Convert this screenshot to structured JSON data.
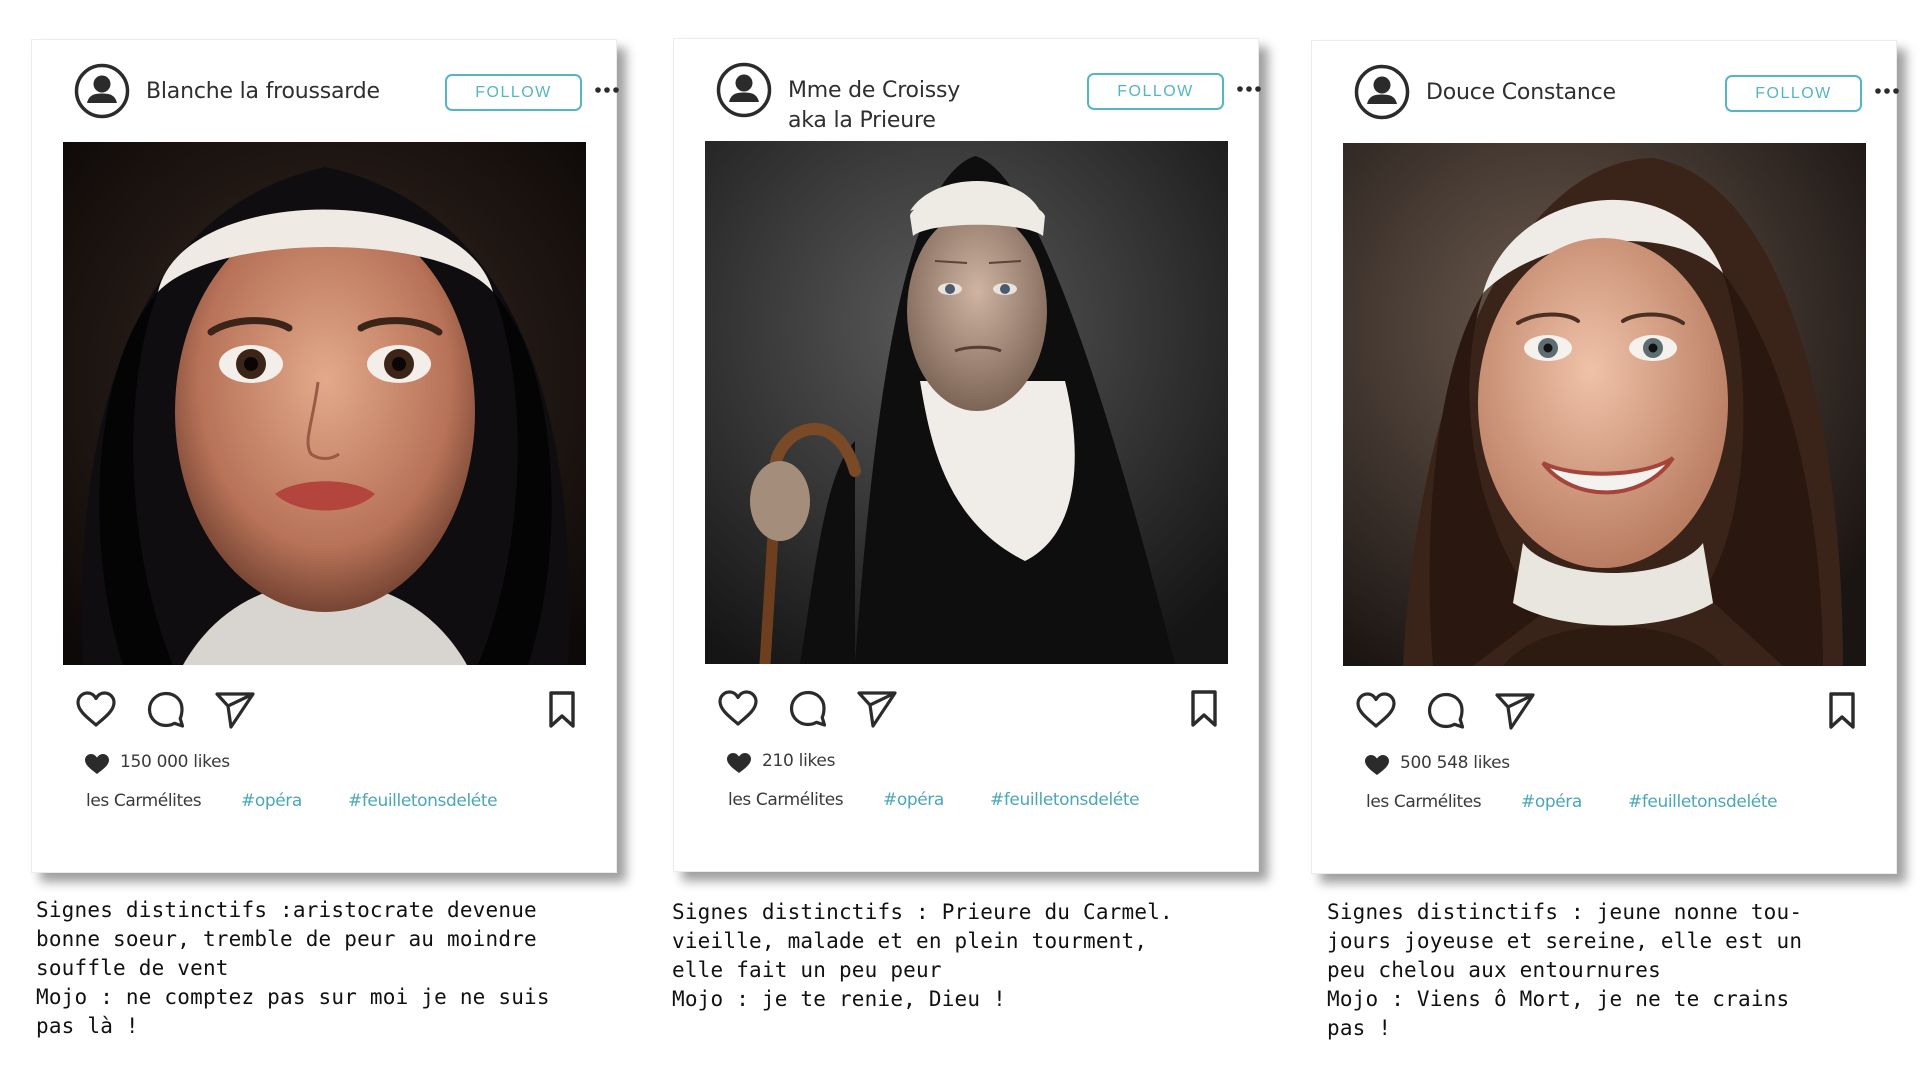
{
  "posts": [
    {
      "username": "Blanche la froussarde",
      "follow_label": "FOLLOW",
      "photo_description_icon": "nun-portrait-young",
      "likes": "150 000 likes",
      "tag_plain": "les Carmélites",
      "tag_1": "#opéra",
      "tag_2": "#feuilletonsdeléte",
      "caption": "Signes distinctifs :aristocrate devenue\nbonne soeur, tremble de peur au moindre\nsouffle de vent\nMojo : ne comptez pas sur moi je ne suis\npas là !"
    },
    {
      "username": "Mme de Croissy\naka la Prieure",
      "follow_label": "FOLLOW",
      "photo_description_icon": "nun-portrait-old",
      "likes": "210 likes",
      "tag_plain": "les Carmélites",
      "tag_1": "#opéra",
      "tag_2": "#feuilletonsdeléte",
      "caption": "Signes distinctifs : Prieure du Carmel.\nvieille, malade et en plein tourment,\nelle fait un peu peur\nMojo : je te renie, Dieu !"
    },
    {
      "username": "Douce Constance",
      "follow_label": "FOLLOW",
      "photo_description_icon": "nun-portrait-smiling",
      "likes": "500 548 likes",
      "tag_plain": "les Carmélites",
      "tag_1": "#opéra",
      "tag_2": "#feuilletonsdeléte",
      "caption": "Signes distinctifs : jeune nonne tou-\njours joyeuse et sereine, elle est un\npeu chelou aux entournures\nMojo : Viens ô Mort, je ne te crains\npas !"
    }
  ],
  "colors": {
    "accent": "#55b6c3",
    "hashtag": "#4aa7b7",
    "text": "#333333",
    "card_bg": "#ffffff"
  },
  "icons": {
    "avatar": "user-circle-icon",
    "more": "more-dots-icon",
    "like": "heart-outline-icon",
    "comment": "comment-bubble-icon",
    "share": "paper-plane-icon",
    "save": "bookmark-icon",
    "likes_heart": "heart-filled-icon"
  }
}
